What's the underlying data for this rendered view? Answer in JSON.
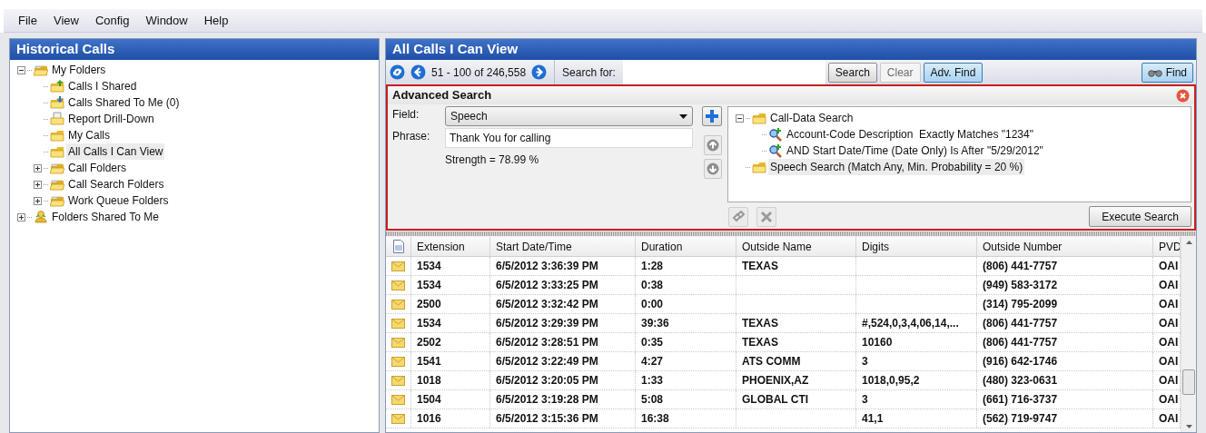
{
  "menu": [
    "File",
    "View",
    "Config",
    "Window",
    "Help"
  ],
  "left_panel": {
    "title": "Historical Calls",
    "tree": [
      {
        "label": "My Folders",
        "kind": "stack",
        "expanded": true,
        "selected": false,
        "children": [
          {
            "label": "Calls I Shared",
            "kind": "shared-out",
            "selected": false
          },
          {
            "label": "Calls Shared To Me (0)",
            "kind": "shared-in",
            "selected": false
          },
          {
            "label": "Report Drill-Down",
            "kind": "report",
            "selected": false
          },
          {
            "label": "My Calls",
            "kind": "folder",
            "selected": false
          },
          {
            "label": "All Calls I Can View",
            "kind": "folder",
            "selected": true
          },
          {
            "label": "Call Folders",
            "kind": "stack",
            "expanded": false,
            "selected": false
          },
          {
            "label": "Call Search Folders",
            "kind": "stack",
            "expanded": false,
            "selected": false
          },
          {
            "label": "Work Queue Folders",
            "kind": "stack",
            "expanded": false,
            "selected": false
          }
        ]
      },
      {
        "label": "Folders Shared To Me",
        "kind": "person",
        "expanded": false,
        "selected": false
      }
    ]
  },
  "right_panel": {
    "title": "All Calls I Can View",
    "toolbar": {
      "range": "51 - 100 of 246,558",
      "search_label": "Search for:",
      "buttons": [
        {
          "label": "Search",
          "pressed": false,
          "disabled": false
        },
        {
          "label": "Clear",
          "pressed": false,
          "disabled": true
        },
        {
          "label": "Adv. Find",
          "pressed": true,
          "disabled": false
        }
      ],
      "find_button": {
        "label": "Find",
        "pressed": true
      }
    },
    "advanced_search": {
      "title": "Advanced Search",
      "field_label": "Field:",
      "field_value": "Speech",
      "phrase_label": "Phrase:",
      "phrase_value": "Thank You for calling",
      "strength": "Strength = 78.99 %",
      "tree": [
        {
          "label": "Call-Data Search",
          "kind": "folder",
          "expanded": true,
          "selected": false,
          "children": [
            {
              "label": "Account-Code Description  Exactly Matches \"1234\"",
              "kind": "criterion",
              "selected": false
            },
            {
              "label": "AND Start Date/Time (Date Only) Is After \"5/29/2012\"",
              "kind": "criterion",
              "selected": false
            }
          ]
        },
        {
          "label": "Speech Search (Match Any, Min. Probability = 20 %)",
          "kind": "folder",
          "selected": true
        }
      ],
      "execute_button": "Execute Search"
    },
    "grid": {
      "columns": [
        "Extension",
        "Start Date/Time",
        "Duration",
        "Outside Name",
        "Digits",
        "Outside Number",
        "PVD"
      ],
      "rows": [
        {
          "extension": "1534",
          "start": "6/5/2012 3:36:39 PM",
          "duration": "1:28",
          "outside_name": "TEXAS",
          "outside_number": "(806) 441-7757",
          "pvd": "OAI"
        },
        {
          "extension": "1534",
          "start": "6/5/2012 3:33:25 PM",
          "duration": "0:38",
          "outside_number": "(949) 583-3172",
          "pvd": "OAI"
        },
        {
          "extension": "2500",
          "start": "6/5/2012 3:32:42 PM",
          "duration": "0:00",
          "outside_number": "(314) 795-2099",
          "pvd": "OAI"
        },
        {
          "extension": "1534",
          "start": "6/5/2012 3:29:39 PM",
          "duration": "39:36",
          "outside_name": "TEXAS",
          "digits": "#,524,0,3,4,06,14,...",
          "outside_number": "(806) 441-7757",
          "pvd": "OAI"
        },
        {
          "extension": "2502",
          "start": "6/5/2012 3:28:51 PM",
          "duration": "0:35",
          "outside_name": "TEXAS",
          "digits": "10160",
          "outside_number": "(806) 441-7757",
          "pvd": "OAI"
        },
        {
          "extension": "1541",
          "start": "6/5/2012 3:22:49 PM",
          "duration": "4:27",
          "outside_name": "ATS COMM",
          "digits": "3",
          "outside_number": "(916) 642-1746",
          "pvd": "OAI"
        },
        {
          "extension": "1018",
          "start": "6/5/2012 3:20:05 PM",
          "duration": "1:33",
          "outside_name": "PHOENIX,AZ",
          "digits": "1018,0,95,2",
          "outside_number": "(480) 323-0631",
          "pvd": "OAI"
        },
        {
          "extension": "1504",
          "start": "6/5/2012 3:19:28 PM",
          "duration": "5:08",
          "outside_name": "GLOBAL CTI",
          "digits": "3",
          "outside_number": "(661) 716-3737",
          "pvd": "OAI"
        },
        {
          "extension": "1016",
          "start": "6/5/2012 3:15:36 PM",
          "duration": "16:38",
          "digits": "41,1",
          "outside_number": "(562) 719-9747",
          "pvd": "OAI"
        }
      ]
    }
  }
}
